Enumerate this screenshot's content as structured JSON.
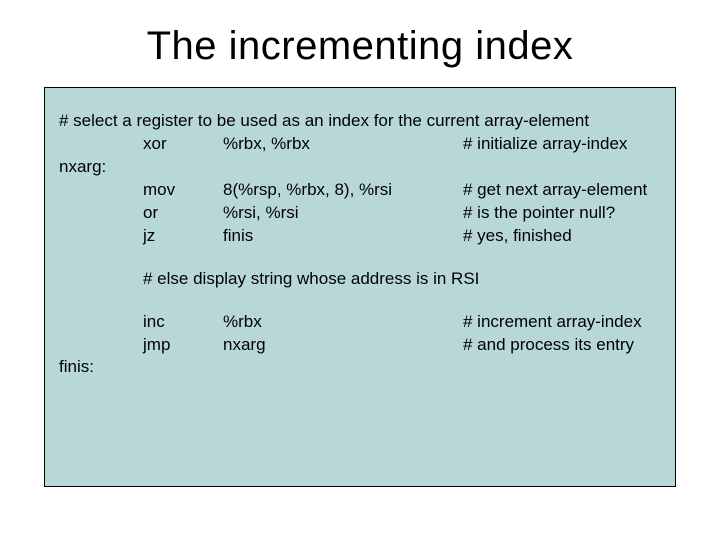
{
  "title": "The incrementing index",
  "comment_top": "# select a register to be used as an index for the current array-element",
  "instr": {
    "xor": {
      "op": "xor",
      "args": "%rbx, %rbx",
      "cmt": "# initialize array-index"
    },
    "mov": {
      "op": "mov",
      "args": "8(%rsp, %rbx, 8), %rsi",
      "cmt": "# get next array-element"
    },
    "or": {
      "op": "or",
      "args": "%rsi, %rsi",
      "cmt": "# is the pointer null?"
    },
    "jz": {
      "op": "jz",
      "args": "finis",
      "cmt": "# yes, finished"
    },
    "inc": {
      "op": "inc",
      "args": "%rbx",
      "cmt": "# increment array-index"
    },
    "jmp": {
      "op": "jmp",
      "args": "nxarg",
      "cmt": "# and process its entry"
    }
  },
  "labels": {
    "nxarg": "nxarg:",
    "finis": "finis:"
  },
  "comment_mid": "# else display string whose  address is in RSI"
}
